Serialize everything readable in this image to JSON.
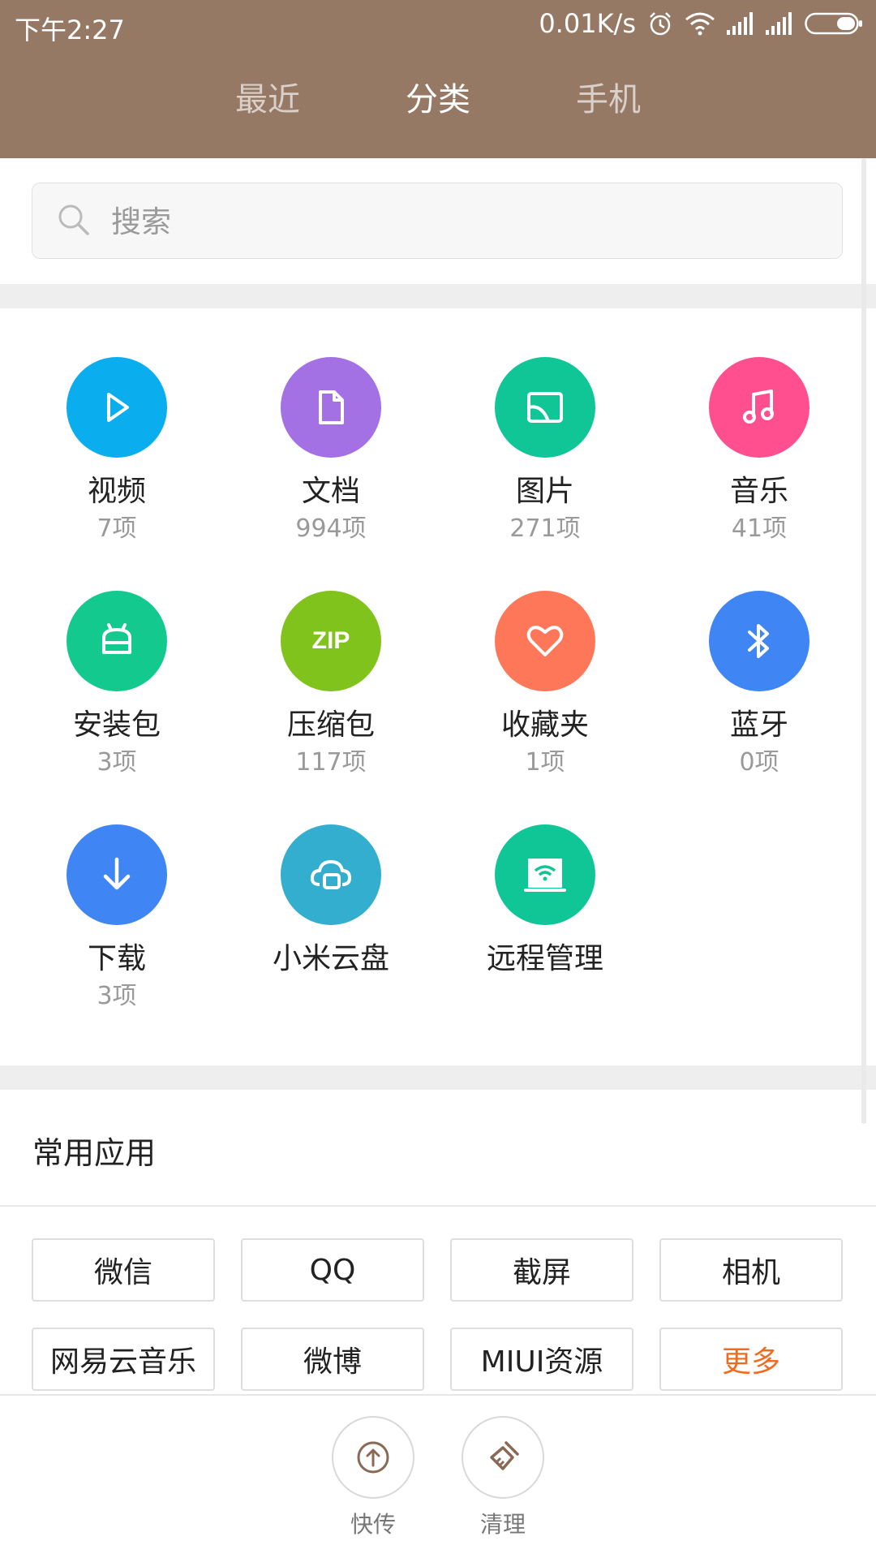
{
  "status_bar": {
    "time": "下午2:27",
    "speed": "0.01K/s"
  },
  "tabs": [
    {
      "label": "最近",
      "active": false
    },
    {
      "label": "分类",
      "active": true
    },
    {
      "label": "手机",
      "active": false
    }
  ],
  "search": {
    "placeholder": "搜索"
  },
  "categories": [
    {
      "name": "视频",
      "count": "7项",
      "icon": "play-icon",
      "color": "#0AAEEF"
    },
    {
      "name": "文档",
      "count": "994项",
      "icon": "document-icon",
      "color": "#A371E3"
    },
    {
      "name": "图片",
      "count": "271项",
      "icon": "image-icon",
      "color": "#10C596"
    },
    {
      "name": "音乐",
      "count": "41项",
      "icon": "music-icon",
      "color": "#FF4F8E"
    },
    {
      "name": "安装包",
      "count": "3项",
      "icon": "android-icon",
      "color": "#14C98E"
    },
    {
      "name": "压缩包",
      "count": "117项",
      "icon": "zip-icon",
      "color": "#80C31C",
      "icon_text": "ZIP"
    },
    {
      "name": "收藏夹",
      "count": "1项",
      "icon": "heart-icon",
      "color": "#FF7759"
    },
    {
      "name": "蓝牙",
      "count": "0项",
      "icon": "bluetooth-icon",
      "color": "#3F85F3"
    },
    {
      "name": "下载",
      "count": "3项",
      "icon": "download-icon",
      "color": "#3F85F3"
    },
    {
      "name": "小米云盘",
      "count": "",
      "icon": "cloud-icon",
      "color": "#34AECF"
    },
    {
      "name": "远程管理",
      "count": "",
      "icon": "remote-wifi-icon",
      "color": "#10C596"
    }
  ],
  "apps_section": {
    "title": "常用应用",
    "items": [
      {
        "label": "微信"
      },
      {
        "label": "QQ"
      },
      {
        "label": "截屏"
      },
      {
        "label": "相机"
      },
      {
        "label": "网易云音乐"
      },
      {
        "label": "微博"
      },
      {
        "label": "MIUI资源"
      },
      {
        "label": "更多",
        "accent": "#EF6C1E"
      }
    ]
  },
  "bottom_actions": [
    {
      "label": "快传",
      "icon": "upload-icon"
    },
    {
      "label": "清理",
      "icon": "broom-icon"
    }
  ],
  "colors": {
    "header": "#957965"
  }
}
